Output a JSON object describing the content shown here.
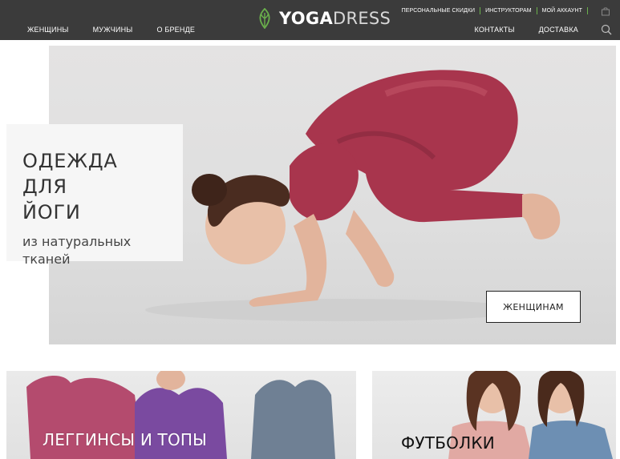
{
  "header": {
    "nav_left": [
      "ЖЕНЩИНЫ",
      "МУЖЧИНЫ",
      "О БРЕНДЕ"
    ],
    "logo": {
      "bold": "YOGA",
      "light": "DRESS"
    },
    "top_links": [
      "ПЕРСОНАЛЬНЫЕ СКИДКИ",
      "ИНСТРУКТОРАМ",
      "МОЙ АККАУНТ"
    ],
    "nav_right": [
      "КОНТАКТЫ",
      "ДОСТАВКА"
    ],
    "icons": {
      "cart": "bag-icon",
      "search": "search-icon",
      "logo": "leaf-icon"
    }
  },
  "hero": {
    "title_line1": "ОДЕЖДА ДЛЯ",
    "title_line2": "ЙОГИ",
    "subtitle_line1": "из натуральных",
    "subtitle_line2": "тканей",
    "button": "ЖЕНЩИНАМ"
  },
  "cards": [
    {
      "label": "ЛЕГГИНСЫ И ТОПЫ"
    },
    {
      "label": "ФУТБОЛКИ"
    }
  ],
  "colors": {
    "header_bg": "#3b3b3b",
    "accent": "#6ab04c",
    "garment": "#a8354d"
  }
}
